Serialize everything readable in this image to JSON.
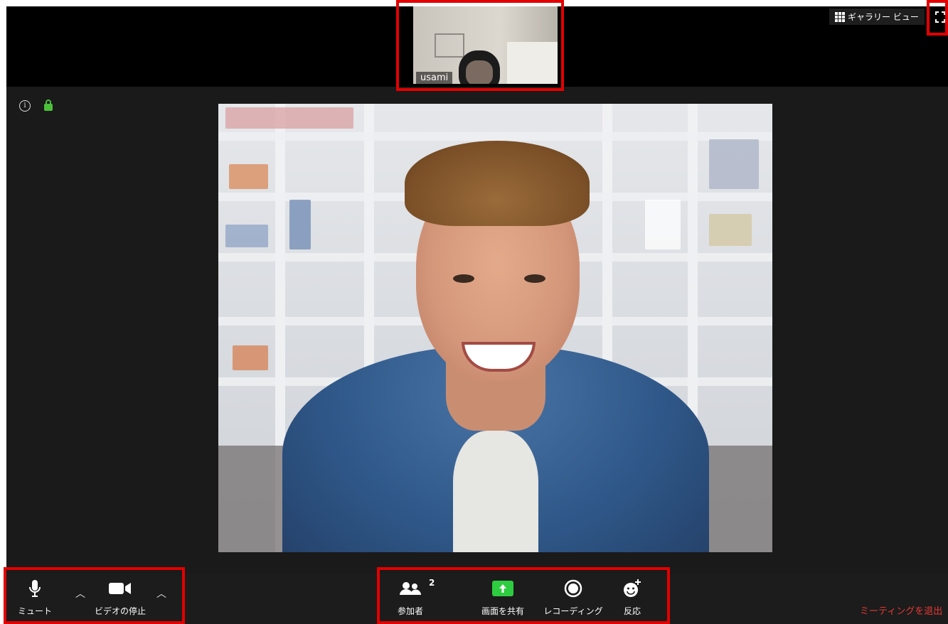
{
  "self_view": {
    "name": "usami"
  },
  "header": {
    "gallery_view_label": "ギャラリー ビュー",
    "gallery_icon": "grid-icon",
    "fullscreen_icon": "fullscreen-icon"
  },
  "meeting_info": {
    "info_icon": "info-icon",
    "lock_icon": "lock-icon",
    "lock_color": "#4bbf3a"
  },
  "toolbar": {
    "mute_label": "ミュート",
    "video_label": "ビデオの停止",
    "participants_label": "参加者",
    "participants_count": "2",
    "share_label": "画面を共有",
    "record_label": "レコーディング",
    "reactions_label": "反応",
    "leave_label": "ミーティングを退出",
    "share_color": "#2ecc40",
    "leave_color": "#e53935"
  },
  "annotations": {
    "highlight_color": "#e30000"
  }
}
